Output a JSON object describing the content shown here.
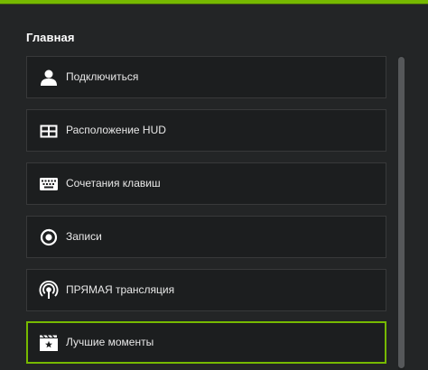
{
  "section": {
    "title": "Главная"
  },
  "menu": {
    "items": [
      {
        "label": "Подключиться",
        "icon": "user-icon"
      },
      {
        "label": "Расположение HUD",
        "icon": "hud-layout-icon"
      },
      {
        "label": "Сочетания клавиш",
        "icon": "keyboard-icon"
      },
      {
        "label": "Записи",
        "icon": "recordings-icon"
      },
      {
        "label": "ПРЯМАЯ трансляция",
        "icon": "broadcast-icon"
      },
      {
        "label": "Лучшие моменты",
        "icon": "highlights-icon",
        "selected": true
      }
    ]
  },
  "colors": {
    "accent": "#76b900",
    "background": "#232526",
    "item_background": "#1c1e1f"
  }
}
